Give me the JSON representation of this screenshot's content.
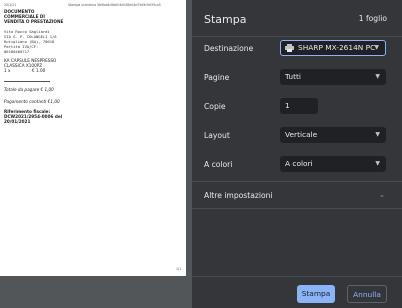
{
  "preview": {
    "header_left": "20/1/21",
    "header_center": "Stampa scontrino 5b9ba8c6bb54e048e04e33d9c9d35ca5",
    "doc_title_1": "DOCUMENTO",
    "doc_title_2": "COMMERCIALE DI",
    "doc_title_3": "VENDITA O PRESTAZIONE",
    "seller_lines": [
      "Vito Rocco Gagliardi",
      "VIA G. P. COLANGELI 1/6",
      "Rutigliano (BA), 70018",
      "Partita IVA/CF:",
      "06180460717"
    ],
    "item_1": "KA CAPSULE NESPRESSO",
    "item_2": "CLASSICA X100PZ",
    "item_qty": "1 x",
    "item_price": "€ 1.00",
    "total": "Totale da pagare € 1,00",
    "payment": "Pagamento contanti €1,00",
    "ref_1": "Riferimento fiscale:",
    "ref_2": "DCW2021/2954-0006 del",
    "ref_3": "20/01/2021",
    "page_number": "1/1"
  },
  "panel": {
    "title": "Stampa",
    "sheet_count": "1 foglio",
    "destination": {
      "label": "Destinazione",
      "value": "SHARP MX-2614N PC",
      "icon": "printer-icon"
    },
    "pages": {
      "label": "Pagine",
      "value": "Tutti"
    },
    "copies": {
      "label": "Copie",
      "value": "1"
    },
    "layout": {
      "label": "Layout",
      "value": "Verticale"
    },
    "color": {
      "label": "A colori",
      "value": "A colori"
    },
    "more_settings": "Altre impostazioni",
    "print_button": "Stampa",
    "cancel_button": "Annulla"
  },
  "colors": {
    "accent": "#8ab4f8",
    "panel_bg": "#35363a",
    "field_bg": "#202124"
  }
}
